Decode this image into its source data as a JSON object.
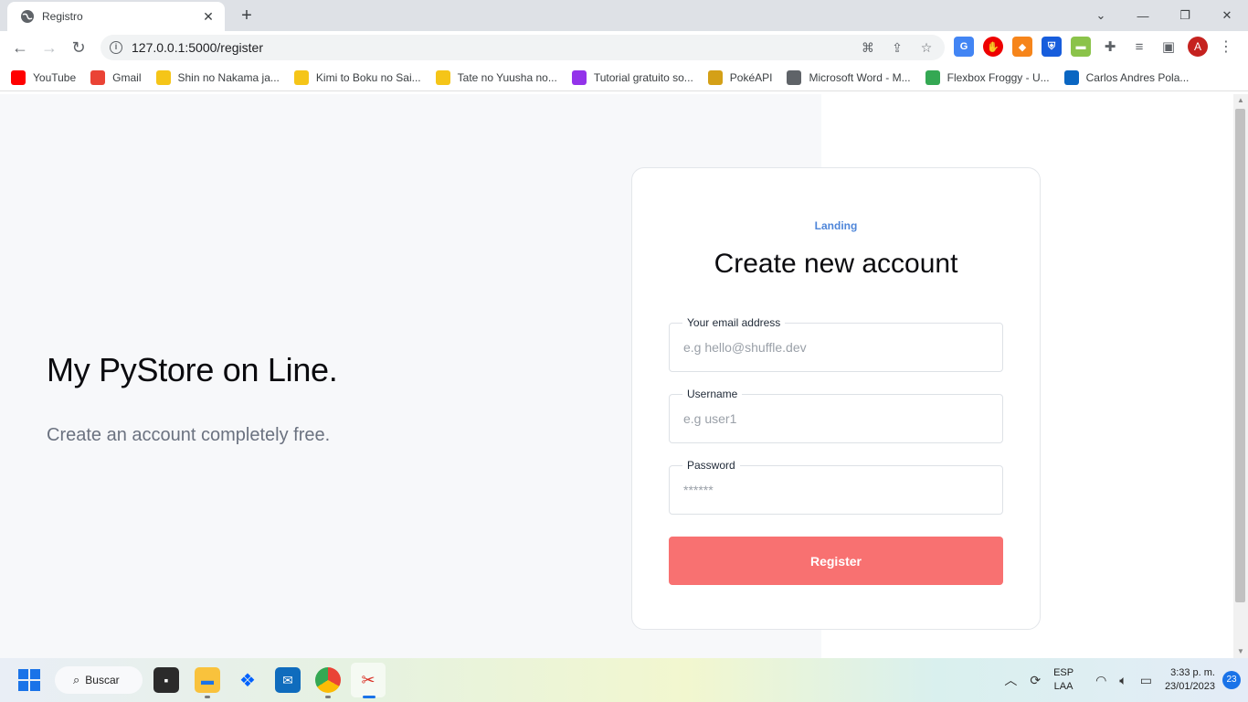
{
  "browser": {
    "tab_title": "Registro",
    "url": "127.0.0.1:5000/register",
    "profile_initial": "A",
    "bookmarks": [
      {
        "label": "YouTube",
        "icon": "youtube-icon",
        "color": "#ff0000"
      },
      {
        "label": "Gmail",
        "icon": "gmail-icon",
        "color": "#ea4335"
      },
      {
        "label": "Shin no Nakama ja...",
        "icon": "bookmark-star-icon",
        "color": "#f5c518"
      },
      {
        "label": "Kimi to Boku no Sai...",
        "icon": "bookmark-star-icon",
        "color": "#f5c518"
      },
      {
        "label": "Tate no Yuusha no...",
        "icon": "bookmark-star-icon",
        "color": "#f5c518"
      },
      {
        "label": "Tutorial gratuito so...",
        "icon": "tutorial-icon",
        "color": "#9333ea"
      },
      {
        "label": "PokéAPI",
        "icon": "pokeapi-icon",
        "color": "#d4a017"
      },
      {
        "label": "Microsoft Word - M...",
        "icon": "globe-icon",
        "color": "#5f6368"
      },
      {
        "label": "Flexbox Froggy - U...",
        "icon": "frog-icon",
        "color": "#34a853"
      },
      {
        "label": "Carlos Andres Pola...",
        "icon": "linkedin-icon",
        "color": "#0a66c2"
      }
    ]
  },
  "page": {
    "hero_title": "My PyStore on Line.",
    "hero_subtitle": "Create an account completely free.",
    "card": {
      "link_label": "Landing",
      "title": "Create new account",
      "email_label": "Your email address",
      "email_placeholder": "e.g hello@shuffle.dev",
      "username_label": "Username",
      "username_placeholder": "e.g user1",
      "password_label": "Password",
      "password_placeholder": "******",
      "register_label": "Register"
    },
    "accent_color": "#f87171"
  },
  "taskbar": {
    "search_label": "Buscar",
    "lang_top": "ESP",
    "lang_bottom": "LAA",
    "time": "3:33 p. m.",
    "date": "23/01/2023",
    "notifications": "23"
  }
}
